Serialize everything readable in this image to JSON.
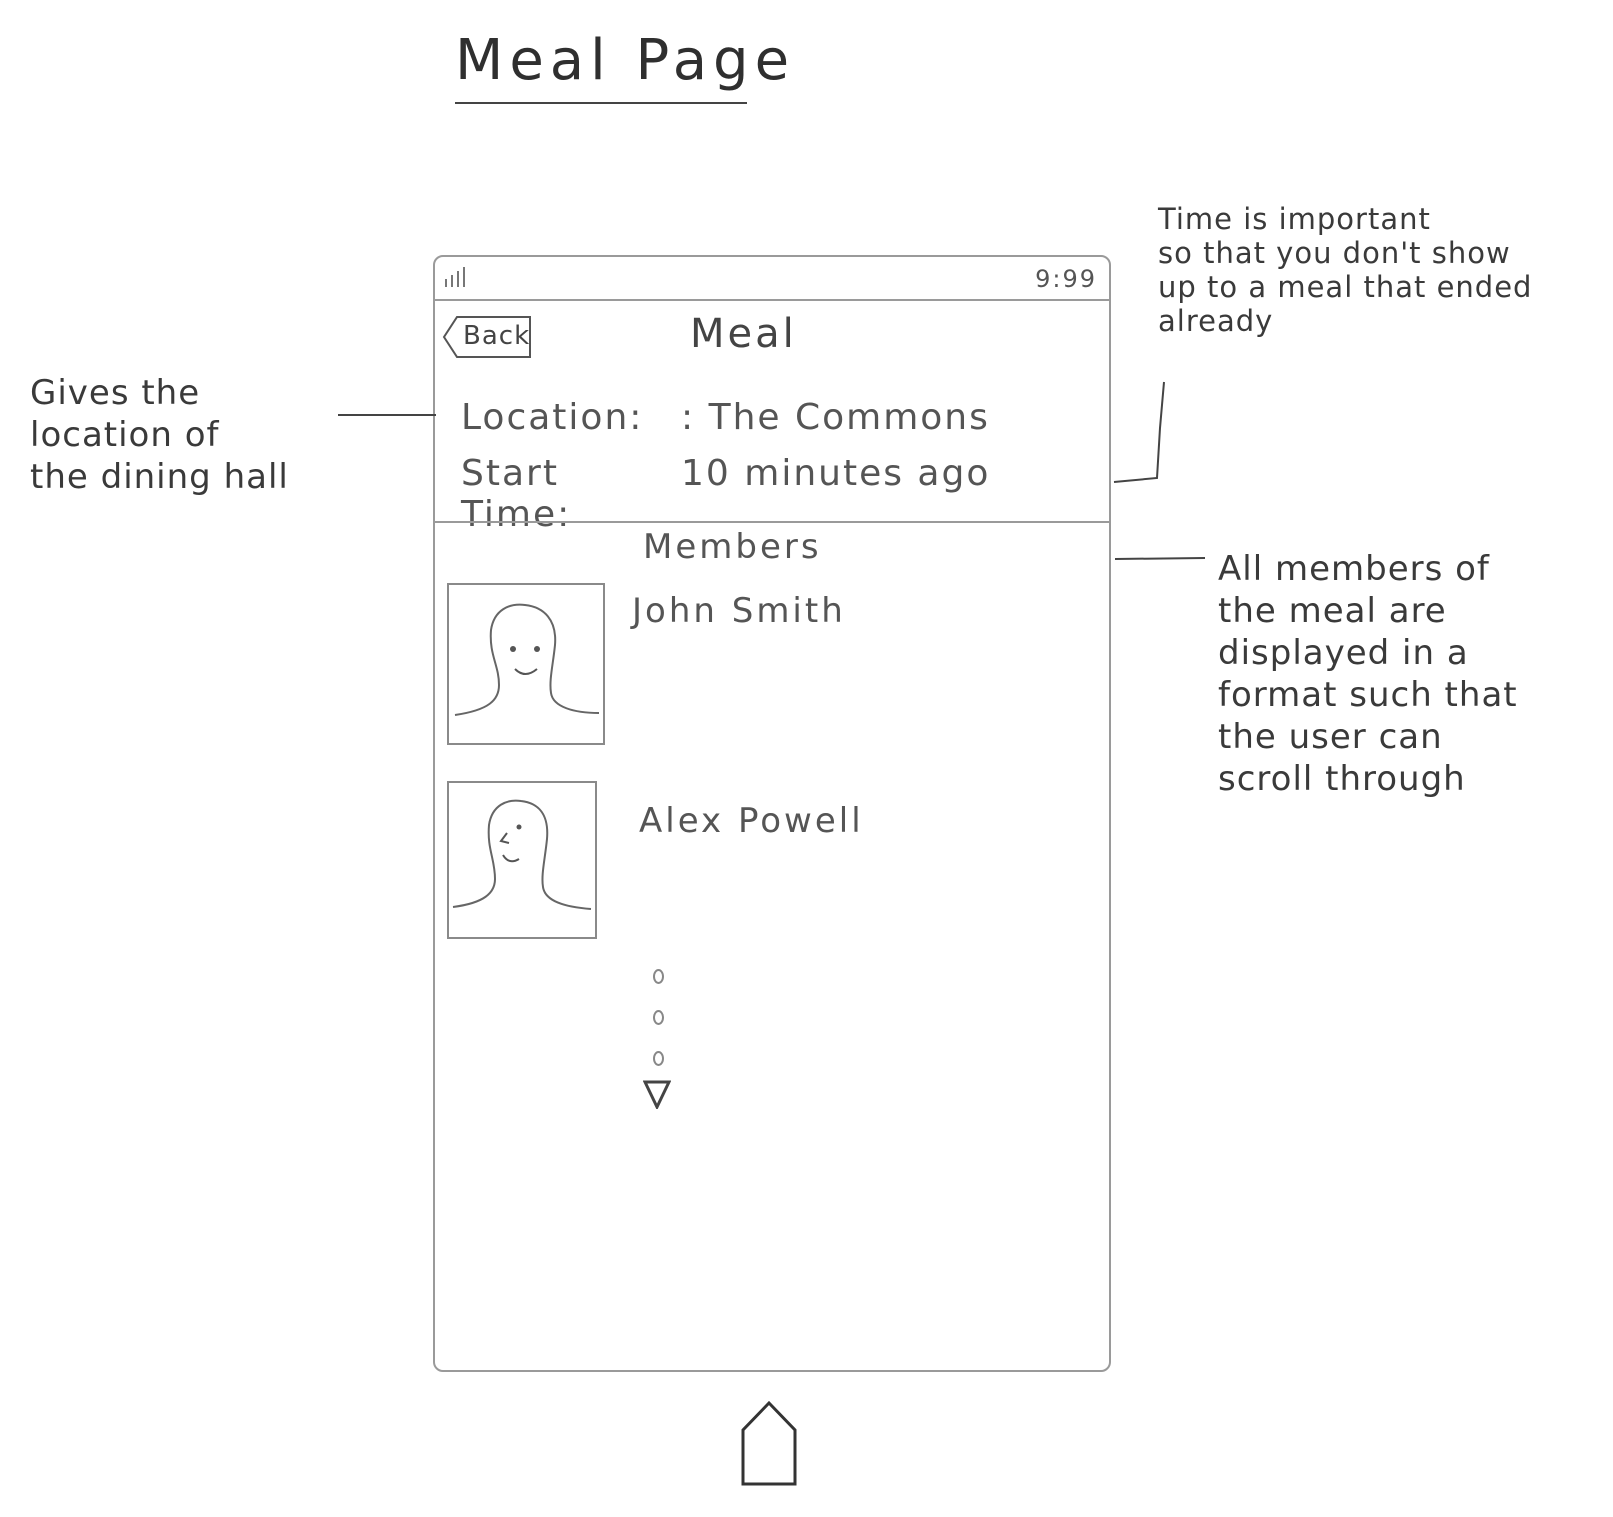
{
  "page_title": "Meal Page",
  "phone": {
    "status_bar": {
      "signal_icon": "signal-bars-icon",
      "time": "9:99"
    },
    "nav": {
      "back_label": "Back",
      "title": "Meal"
    },
    "info": {
      "location_label": "Location:",
      "location_value": ": The Commons",
      "start_time_label": "Start Time:",
      "start_time_value": "10 minutes ago"
    },
    "members_heading": "Members",
    "members": [
      {
        "name": "John Smith",
        "avatar_icon": "person-avatar-icon"
      },
      {
        "name": "Alex Powell",
        "avatar_icon": "person-avatar-icon"
      }
    ],
    "more_indicator_icon": "ellipsis-vertical-icon",
    "scroll_icon": "triangle-down-icon"
  },
  "home_icon": "home-icon",
  "annotations": {
    "location_note": [
      "Gives the",
      "location of",
      "the dining hall"
    ],
    "time_note": [
      "Time is important",
      "so that you don't show",
      "up to a meal that ended",
      "already"
    ],
    "members_note": [
      "All members of",
      "the meal are",
      "displayed in a",
      "format such that",
      "the user can",
      "scroll through"
    ]
  }
}
